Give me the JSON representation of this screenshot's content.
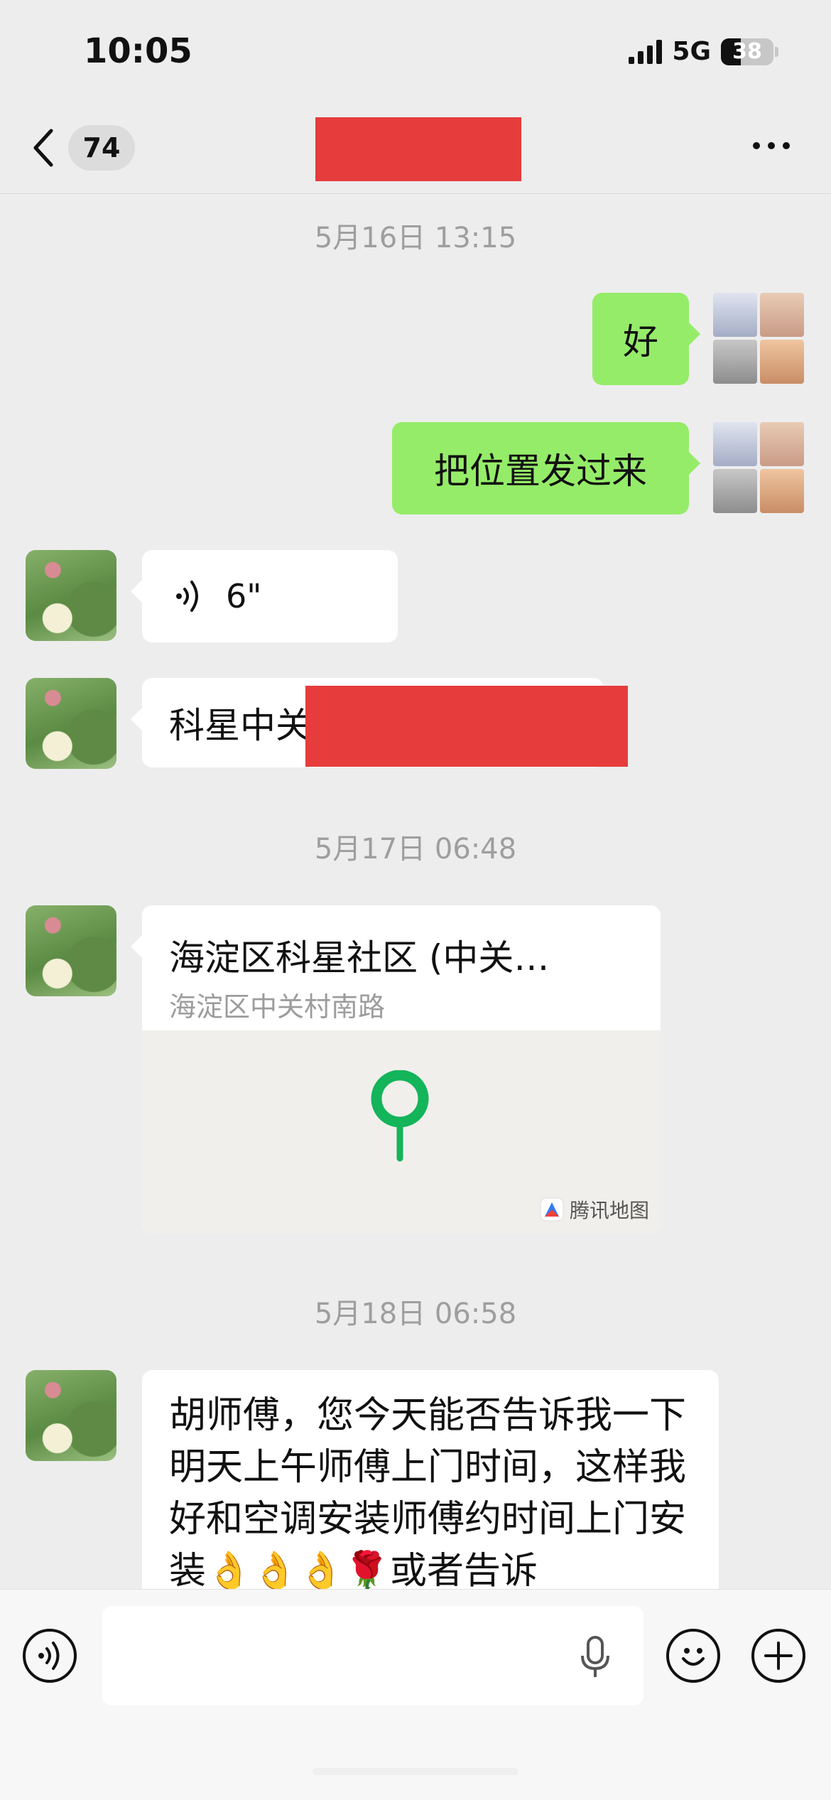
{
  "status": {
    "time": "10:05",
    "network": "5G",
    "battery": "38"
  },
  "nav": {
    "unread_count": "74",
    "title_redacted": true
  },
  "timestamps": [
    "5月16日 13:15",
    "5月17日 06:48",
    "5月18日 06:58"
  ],
  "messages": {
    "m1": {
      "text": "好",
      "side": "right"
    },
    "m2": {
      "text": "把位置发过来",
      "side": "right"
    },
    "m3": {
      "duration": "6\"",
      "side": "left"
    },
    "m4": {
      "text": "科星中关",
      "side": "left"
    },
    "m5": {
      "location_title": "海淀区科星社区 (中关…",
      "location_subtitle": "海淀区中关村南路",
      "map_credit": "腾讯地图",
      "side": "left"
    },
    "m6": {
      "text": "胡师傅，您今天能否告诉我一下明天上午师傅上门时间，这样我好和空调安装师傅约时间上门安装👌👌👌🌹或者告诉",
      "side": "left"
    }
  },
  "colors": {
    "self_bubble": "#95ec69",
    "other_bubble": "#ffffff",
    "background": "#ededed",
    "redaction": "#e63c3c",
    "map_pin": "#13b45a"
  },
  "icons": [
    "back-chevron-icon",
    "more-icon",
    "voice-wave-icon",
    "map-pin-icon",
    "tencent-map-icon",
    "voice-toggle-icon",
    "microphone-icon",
    "emoji-icon",
    "plus-icon"
  ]
}
